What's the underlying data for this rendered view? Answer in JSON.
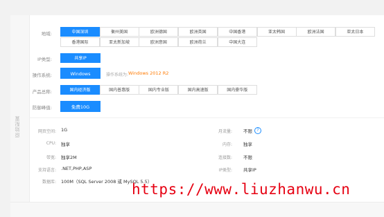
{
  "sidebar": {
    "label": "原始配置"
  },
  "region": {
    "label": "地域:",
    "options": [
      "中国深圳",
      "衡州美国",
      "欧洲德国",
      "欧洲英国",
      "中国香港",
      "亚太韩国",
      "欧洲法国",
      "亚太日本",
      "香港国际",
      "亚太新加坡",
      "欧洲意国",
      "欧洲荷兰",
      "中国大连"
    ],
    "selected": "中国深圳"
  },
  "ip_type": {
    "label": "IP类型:",
    "value": "共享IP"
  },
  "os": {
    "label": "操作系统:",
    "value": "Windows",
    "note": "操作系统为:",
    "note_value": "Windows 2012 R2"
  },
  "product": {
    "label": "产品总称:",
    "options": [
      "国内经济版",
      "国内普惠版",
      "国内专业版",
      "国内高速版",
      "国内豪华版"
    ],
    "selected": "国内经济版"
  },
  "defense": {
    "label": "防御峰值:",
    "value": "免费10G"
  },
  "specs": {
    "left": [
      {
        "label": "网页空间:",
        "value": "1G"
      },
      {
        "label": "CPU:",
        "value": "独享"
      },
      {
        "label": "带宽:",
        "value": "独享2M"
      },
      {
        "label": "支持语言:",
        "value": ".NET,PHP,ASP"
      },
      {
        "label": "数据库:",
        "value": "100M（SQL Server 2008 或 MySQL 5.5）"
      }
    ],
    "right": [
      {
        "label": "月流量:",
        "value": "不限"
      },
      {
        "label": "内存:",
        "value": "独享"
      },
      {
        "label": "连接数:",
        "value": "不限"
      },
      {
        "label": "IP类型:",
        "value": "共享IP"
      }
    ],
    "help_glyph": "?"
  },
  "watermark": "https://www.liuzhanwu.cn"
}
